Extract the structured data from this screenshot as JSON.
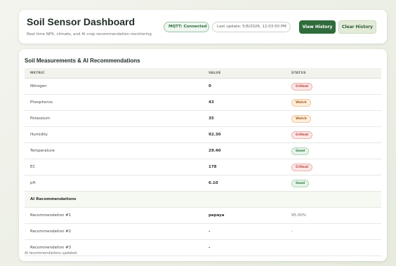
{
  "header": {
    "title": "Soil Sensor Dashboard",
    "subtitle": "Real time NPK, climate, and AI crop recommendation monitoring",
    "mqtt_status": "MQTT: Connected",
    "last_update": "Last update: 5/8/2026, 12:03:50 PM",
    "view_history_label": "View History",
    "clear_history_label": "Clear History"
  },
  "measurements": {
    "section_title": "Soil Measurements & AI Recommendations",
    "columns": [
      "METRIC",
      "VALUE",
      "STATUS"
    ],
    "rows": [
      {
        "metric": "Nitrogen",
        "value": "0",
        "status": "Critical"
      },
      {
        "metric": "Phosphorus",
        "value": "43",
        "status": "Watch"
      },
      {
        "metric": "Potassium",
        "value": "35",
        "status": "Watch"
      },
      {
        "metric": "Humidity",
        "value": "92.30",
        "status": "Critical"
      },
      {
        "metric": "Temperature",
        "value": "29.40",
        "status": "Good"
      },
      {
        "metric": "EC",
        "value": "178",
        "status": "Critical"
      },
      {
        "metric": "pH",
        "value": "6.10",
        "status": "Good"
      }
    ],
    "ai_section_label": "AI Recommendations",
    "recommendations": [
      {
        "label": "Recommendation #1",
        "value": "papaya",
        "confidence": "95.00%"
      },
      {
        "label": "Recommendation #2",
        "value": "-",
        "confidence": "-"
      },
      {
        "label": "Recommendation #3",
        "value": "-",
        "confidence": ""
      }
    ],
    "footer_note": "AI recommendations updated."
  },
  "colors": {
    "primary": "#2f6b3b",
    "critical": "#b2332b",
    "watch": "#a65a14",
    "good": "#2f7a43"
  }
}
